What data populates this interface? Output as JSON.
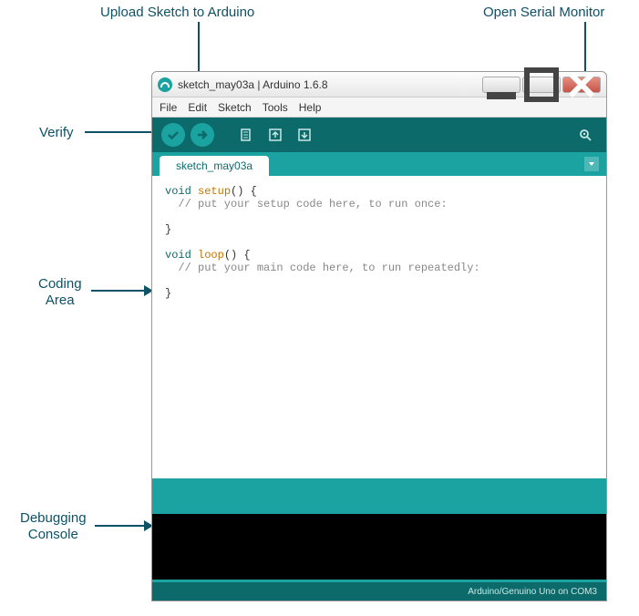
{
  "labels": {
    "upload": "Upload Sketch to Arduino",
    "serial": "Open Serial Monitor",
    "verify": "Verify",
    "coding_area_l1": "Coding",
    "coding_area_l2": "Area",
    "debug_l1": "Debugging",
    "debug_l2": "Console"
  },
  "window": {
    "title": "sketch_may03a | Arduino 1.6.8"
  },
  "menu": {
    "file": "File",
    "edit": "Edit",
    "sketch": "Sketch",
    "tools": "Tools",
    "help": "Help"
  },
  "tab": {
    "name": "sketch_may03a"
  },
  "code": {
    "kw_void1": "void",
    "fn_setup": "setup",
    "paren_brace1": "() {",
    "comment_setup": "  // put your setup code here, to run once:",
    "close_brace1": "}",
    "kw_void2": "void",
    "fn_loop": "loop",
    "paren_brace2": "() {",
    "comment_loop": "  // put your main code here, to run repeatedly:",
    "close_brace2": "}"
  },
  "footer": {
    "board_info": "Arduino/Genuino Uno on COM3"
  },
  "colors": {
    "label": "#0d5166",
    "teal_dark": "#0d6a6b",
    "teal_light": "#1aa3a0"
  }
}
